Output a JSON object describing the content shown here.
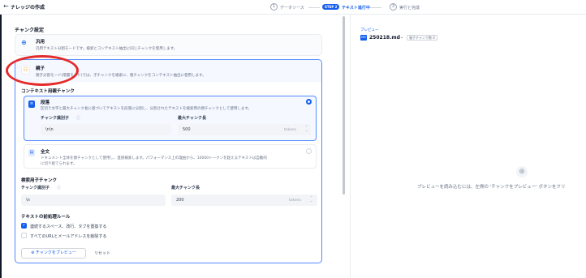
{
  "header": {
    "title": "ナレッジの作成",
    "steps": [
      {
        "num": "1",
        "label": "データソース"
      },
      {
        "badge": "STEP 2",
        "label": "テキスト進行中"
      },
      {
        "num": "3",
        "label": "実行と完成"
      }
    ]
  },
  "chunk_settings": {
    "title": "チャンク設定",
    "general": {
      "title": "汎用",
      "desc": "汎用テキスト分割モードです。検索とコンテキスト抽出に同じチャンクを使用します。"
    },
    "parent_child": {
      "title": "親子",
      "desc": "親子分割モード(階層モード)では、子チャンクを検索に、親チャンクをコンテキスト抽出に使用します。",
      "context_title": "コンテキスト用親チャンク",
      "paragraph": {
        "title": "段落",
        "desc": "区切り文字と最大チャンク長に基づいてテキストを段落に分割し、分割されたテキストを検索用の親チャンクとして使用します。",
        "delimiter_label": "チャンク識別子",
        "delimiter_value": "\\n\\n",
        "maxlen_label": "最大チャンク長",
        "maxlen_value": "500",
        "unit": "tokens"
      },
      "full_doc": {
        "title": "全文",
        "desc_line1": "ドキュメント全体を親チャンクとして使用し、直接検索します。パフォーマンス上の理由から、10000トークンを超えるテキストは自動的",
        "desc_line2": "に切り捨てられます。"
      },
      "child": {
        "title": "検索用子チャンク",
        "delimiter_label": "チャンク識別子",
        "delimiter_value": "\\n",
        "maxlen_label": "最大チャンク長",
        "maxlen_value": "200",
        "unit": "tokens"
      },
      "rules": {
        "title": "テキストの前処理ルール",
        "items": [
          {
            "label": "連続するスペース、改行、タブを置換する",
            "checked": true
          },
          {
            "label": "すべてのURLとメールアドレスを削除する",
            "checked": false
          }
        ]
      },
      "preview_button": "チャンクをプレビュー",
      "reset_button": "リセット"
    }
  },
  "preview": {
    "label": "プレビュー",
    "file_name": "250218.md",
    "badge": "親子チャンク数 0",
    "message": "プレビューを読み込むには、左側の 'チャンクをプレビュー' ボタンをクリ"
  },
  "colors": {
    "accent": "#155eef",
    "annotation": "#e32b2b"
  }
}
